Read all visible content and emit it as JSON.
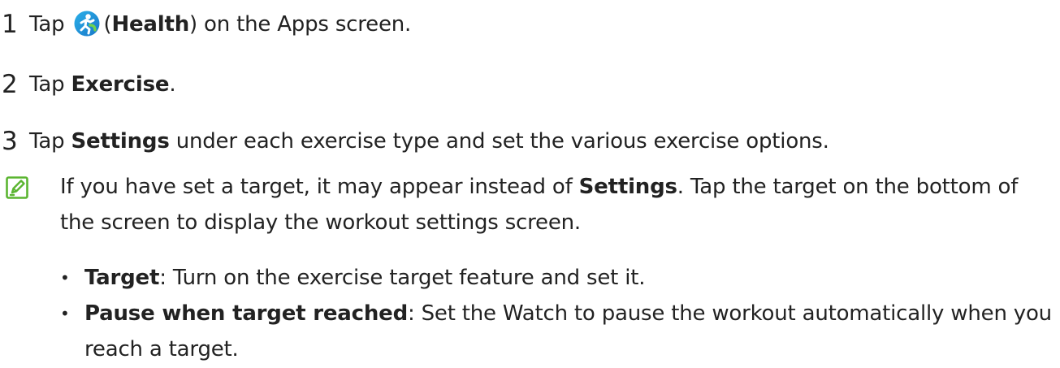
{
  "steps": [
    {
      "number": "1",
      "pre": "Tap ",
      "app_icon": "health-app-icon",
      "open_paren": "(",
      "bold": "Health",
      "post": ") on the Apps screen."
    },
    {
      "number": "2",
      "pre": "Tap ",
      "bold": "Exercise",
      "post": "."
    },
    {
      "number": "3",
      "pre": "Tap ",
      "bold": "Settings",
      "post": " under each exercise type and set the various exercise options."
    }
  ],
  "note": {
    "icon": "note-pencil-icon",
    "text_before": "If you have set a target, it may appear instead of ",
    "bold": "Settings",
    "text_after": ". Tap the target on the bottom of the screen to display the workout settings screen."
  },
  "bullets": [
    {
      "bold": "Target",
      "text": ": Turn on the exercise target feature and set it."
    },
    {
      "bold": "Pause when target reached",
      "text": ": Set the Watch to pause the workout automatically when you reach a target."
    }
  ],
  "colors": {
    "text": "#222222",
    "note_icon": "#5bb531",
    "health_icon_blue": "#1a9be0",
    "health_icon_green": "#53b848"
  }
}
